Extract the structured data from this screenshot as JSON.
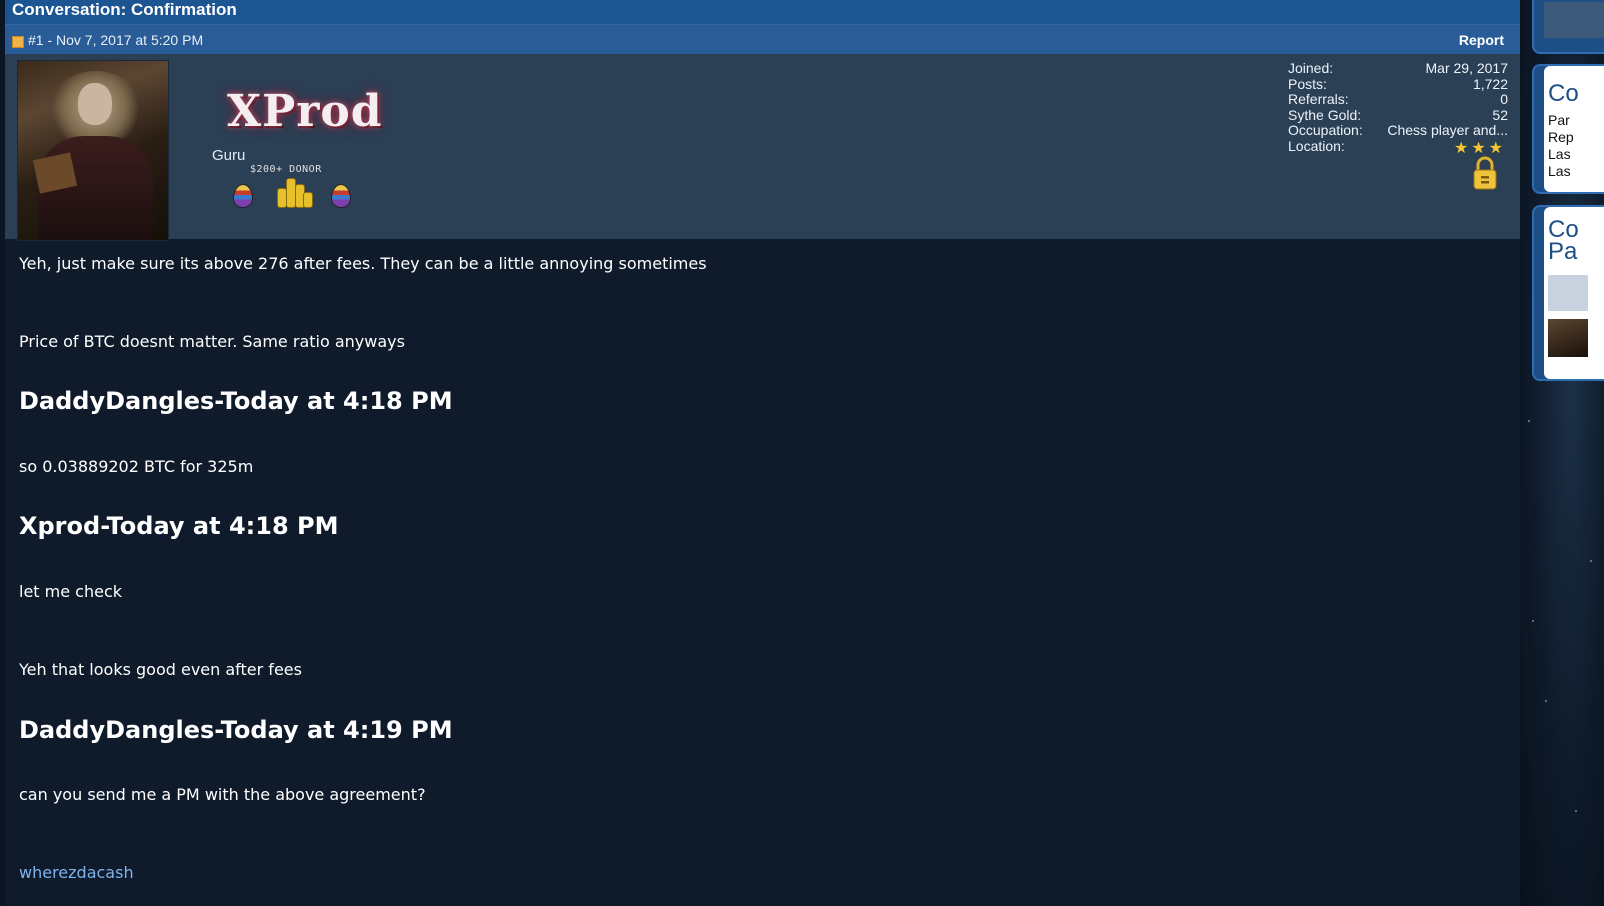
{
  "conversation": {
    "title": "Conversation: Confirmation"
  },
  "post": {
    "meta": "#1 - Nov 7, 2017 at 5:20 PM",
    "report_label": "Report"
  },
  "user": {
    "logo_text": "XProd",
    "title": "Guru",
    "donor_badge": "$200+ DONOR",
    "stats": [
      {
        "label": "Joined:",
        "value": "Mar 29, 2017"
      },
      {
        "label": "Posts:",
        "value": "1,722"
      },
      {
        "label": "Referrals:",
        "value": "0"
      },
      {
        "label": "Sythe Gold:",
        "value": "52"
      },
      {
        "label": "Occupation:",
        "value": "Chess player and..."
      },
      {
        "label": "Location:",
        "value": ""
      }
    ],
    "rating_stars": 3
  },
  "body": {
    "lines": [
      "Yeh, just make sure its above 276 after fees. They can be a little annoying sometimes",
      "Price of BTC doesnt matter. Same ratio anyways",
      "DaddyDangles-Today at 4:18 PM",
      "so 0.03889202 BTC for 325m",
      "Xprod-Today at 4:18 PM",
      "let me check",
      "Yeh that looks good even after fees",
      "DaddyDangles-Today at 4:19 PM",
      "can you send me a PM with the above agreement?"
    ],
    "signature_link": "wherezdacash"
  },
  "sidebar": {
    "box1": {
      "heading": "Co",
      "lines": [
        "Par",
        "Rep",
        "Las",
        "Las"
      ]
    },
    "box2": {
      "heading": "Co Pa"
    }
  },
  "colors": {
    "title_bar": "#1c5591",
    "meta_bar": "#2a5d97",
    "user_panel": "#2b3f55",
    "body_bg": "#0f1b2b",
    "link": "#7fb3ef",
    "star": "#f4c531"
  }
}
